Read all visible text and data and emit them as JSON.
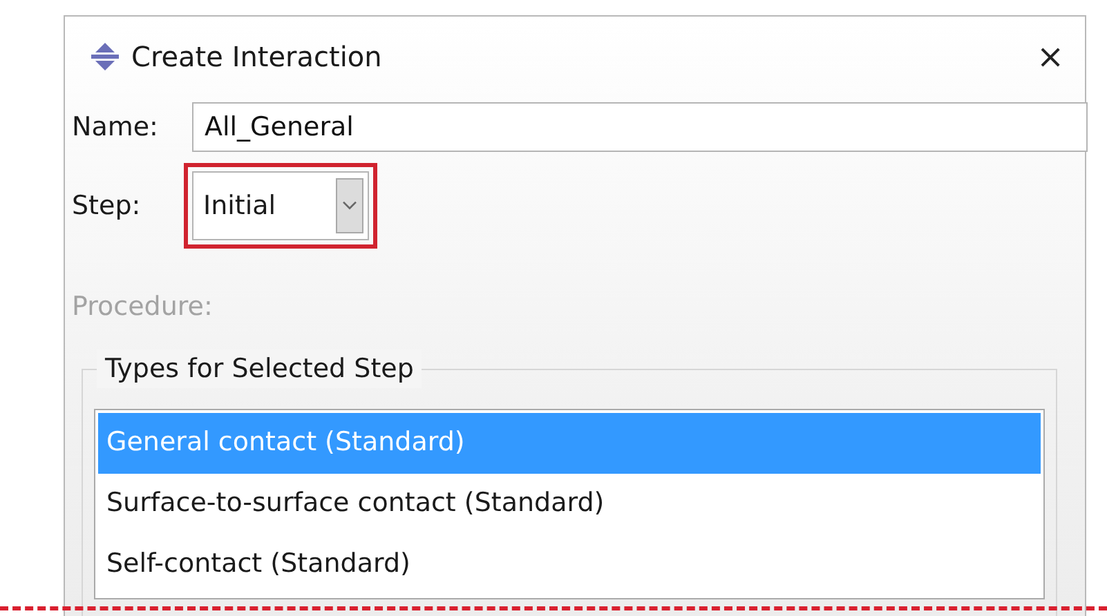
{
  "window": {
    "title": "Create Interaction",
    "close": "×"
  },
  "name_field": {
    "label": "Name:",
    "value": "All_General"
  },
  "step_field": {
    "label": "Step:",
    "value": "Initial",
    "highlighted": true
  },
  "procedure": {
    "label": "Procedure:",
    "disabled": true
  },
  "types_group": {
    "title": "Types for Selected Step",
    "items": [
      {
        "label": "General contact (Standard)",
        "selected": true
      },
      {
        "label": "Surface-to-surface contact (Standard)",
        "selected": false
      },
      {
        "label": "Self-contact (Standard)",
        "selected": false
      }
    ]
  },
  "cut_line": {
    "color": "#d9202f"
  }
}
